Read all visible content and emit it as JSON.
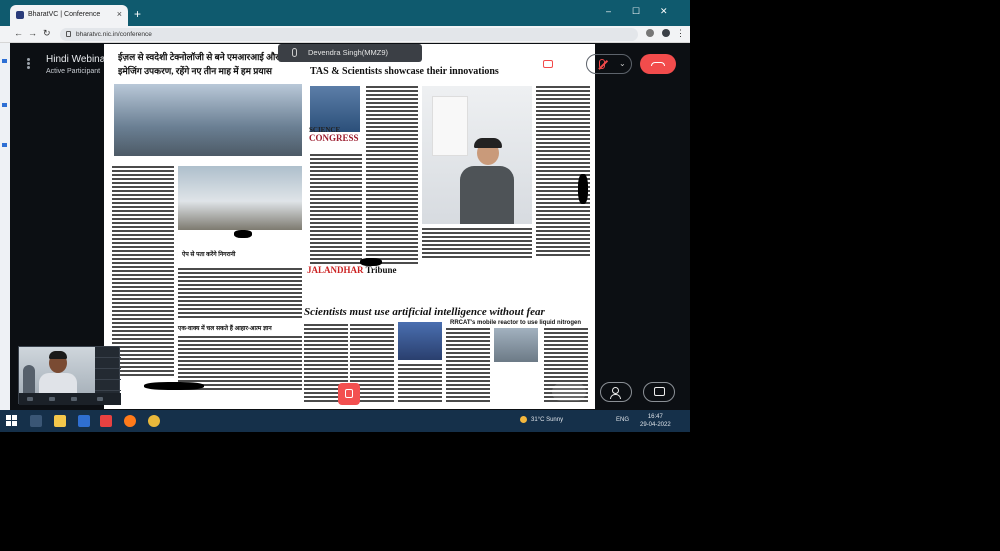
{
  "browser": {
    "tab_title": "BharatVC | Conference",
    "tab_close": "×",
    "new_tab": "+",
    "url": "bharatvc.nic.in/conference",
    "window_controls": {
      "minimize": "–",
      "maximize": "☐",
      "close": "✕"
    }
  },
  "conference": {
    "meeting_title": "Hindi Webinar",
    "participant_role": "Active Participant",
    "active_speaker": "Devendra Singh(MMZ9)"
  },
  "shared_screen": {
    "hindi_headline_1": "ईज़ल से स्वदेशी टेक्नोलॉजी से बने एमआरआई और",
    "hindi_headline_2": "इमेजिंग उपकरण, रहेंगे नए तीन माह में हम प्रयास",
    "headline_en_top": "TAS & Scientists showcase their innovations",
    "science_logo_line1": "SCIENCE",
    "science_logo_line2": "CONGRESS",
    "paper_name_colored": "JALANDHAR",
    "paper_name_dark": "Tribune",
    "main_headline_en": "Scientists must use artificial intelligence without fear",
    "sub_headline_en": "RRCAT's mobile reactor to use liquid nitrogen",
    "hindi_subhead": "ऐप से पता करेंगे निगरानी",
    "hindi_col_head": "एक-वाक्य में चल सकते हैं आहार-आत्म ज्ञान"
  },
  "taskbar": {
    "weather": "31°C Sunny",
    "language": "ENG",
    "time": "16:47",
    "date": "29-04-2022"
  },
  "colors": {
    "titlebar": "#0f5a6e",
    "end_call": "#f24c4c",
    "muted": "#f24a4a",
    "taskbar": "#15304a"
  },
  "icons": [
    "menu-icon",
    "camera-off-icon",
    "mic-off-icon",
    "end-call-icon",
    "participants-icon",
    "chat-icon",
    "screen-share-icon",
    "windows-start-icon",
    "weather-icon"
  ]
}
